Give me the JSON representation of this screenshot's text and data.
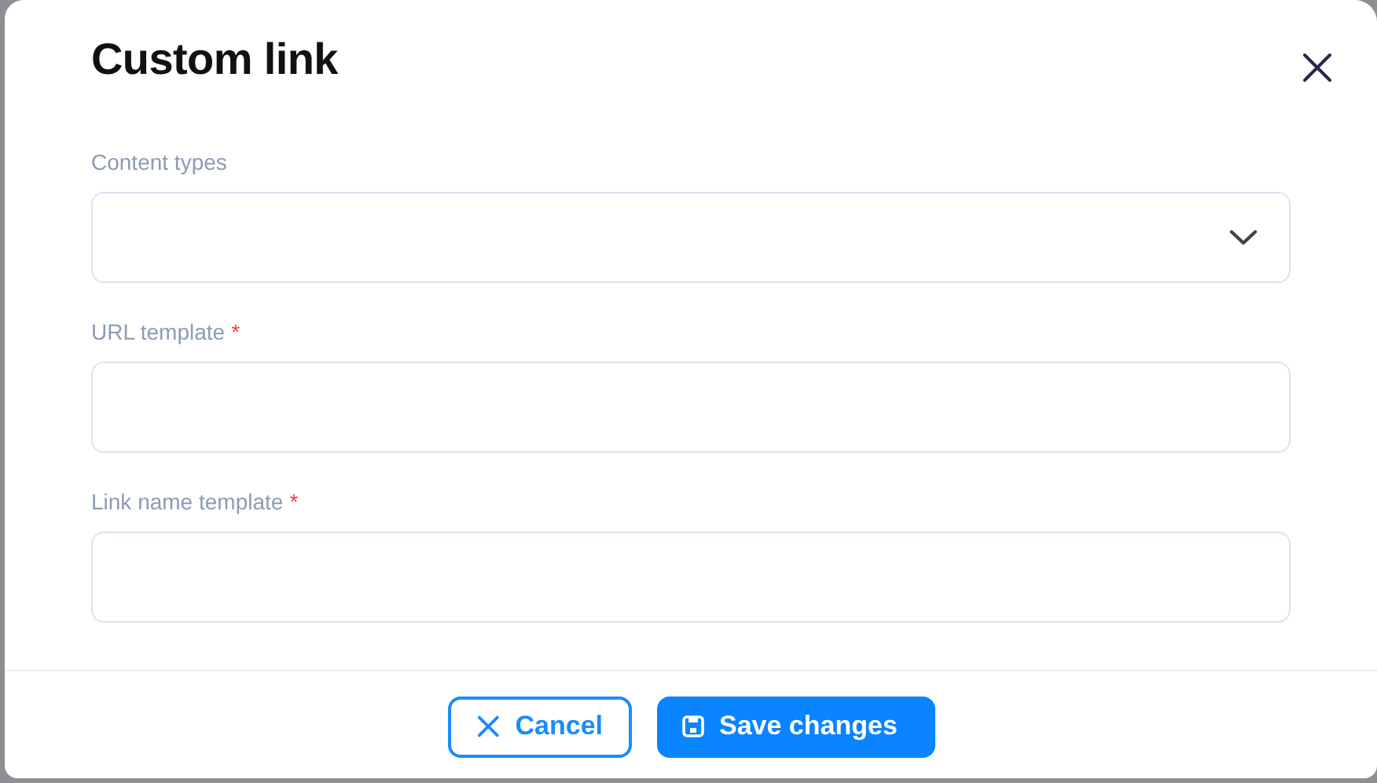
{
  "dialog": {
    "title": "Custom link"
  },
  "fields": [
    {
      "kind": "select",
      "label": "Content types"
    },
    {
      "kind": "text",
      "label": "URL template",
      "required_mark": "*"
    },
    {
      "kind": "text",
      "label": "Link name template",
      "required_mark": "*"
    }
  ],
  "buttons": [
    {
      "kind": "secondary",
      "label": "Cancel"
    },
    {
      "kind": "primary",
      "label": "Save changes"
    }
  ]
}
